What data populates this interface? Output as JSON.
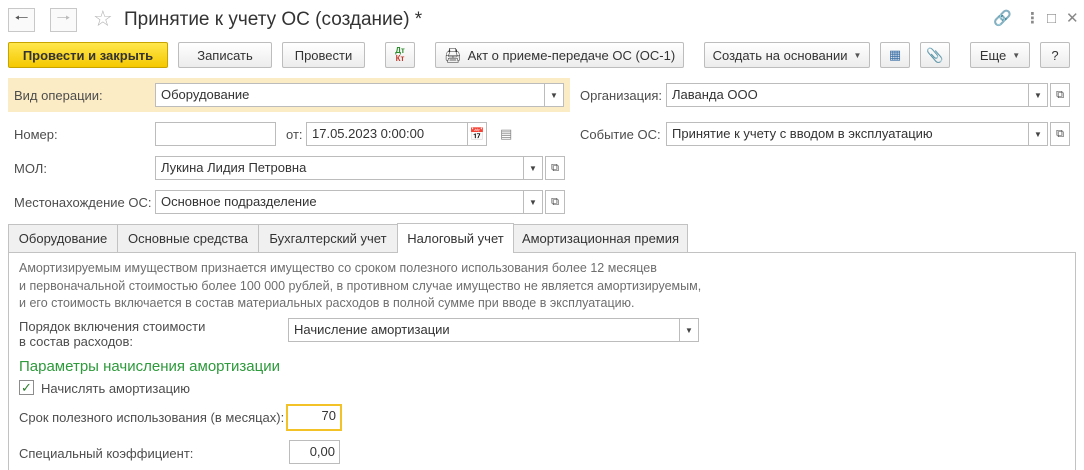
{
  "window": {
    "title": "Принятие к учету ОС (создание) *"
  },
  "toolbar": {
    "post_close_label": "Провести и закрыть",
    "save_label": "Записать",
    "post_label": "Провести",
    "dtkt_top": "Дт",
    "dtkt_bottom": "Кт",
    "print_act_label": "Акт о приеме-передаче ОС (ОС-1)",
    "create_based_label": "Создать на основании",
    "more_label": "Еще",
    "help_label": "?"
  },
  "header": {
    "operation_type_label": "Вид операции:",
    "operation_type_value": "Оборудование",
    "organization_label": "Организация:",
    "organization_value": "Лаванда ООО",
    "number_label": "Номер:",
    "number_value": "",
    "date_from_label": "от:",
    "date_value": "17.05.2023  0:00:00",
    "event_label": "Событие ОС:",
    "event_value": "Принятие к учету с вводом в эксплуатацию",
    "mol_label": "МОЛ:",
    "mol_value": "Лукина Лидия Петровна",
    "location_label": "Местонахождение ОС:",
    "location_value": "Основное подразделение"
  },
  "tabs": [
    {
      "label": "Оборудование"
    },
    {
      "label": "Основные средства"
    },
    {
      "label": "Бухгалтерский учет"
    },
    {
      "label": "Налоговый учет"
    },
    {
      "label": "Амортизационная премия"
    }
  ],
  "tax_tab": {
    "info_line1": "Амортизируемым имуществом признается имущество со сроком полезного использования более 12 месяцев",
    "info_line2": "и первоначальной стоимостью более 100 000 рублей, в противном случае имущество не является амортизируемым,",
    "info_line3": "и его стоимость включается в состав материальных расходов в полной сумме при вводе в эксплуатацию.",
    "expense_order_label_line1": "Порядок включения стоимости",
    "expense_order_label_line2": "в состав расходов:",
    "expense_order_value": "Начисление амортизации",
    "section_title": "Параметры начисления амортизации",
    "accrue_checkbox_label": "Начислять амортизацию",
    "accrue_checked": true,
    "useful_life_label": "Срок полезного использования (в месяцах):",
    "useful_life_value": "70",
    "special_coef_label": "Специальный коэффициент:",
    "special_coef_value": "0,00"
  },
  "colors": {
    "primary_button": "#f5c800",
    "highlight_row": "#fbecc5",
    "section_title": "#2d9a3b",
    "focus_border": "#f3c226"
  }
}
